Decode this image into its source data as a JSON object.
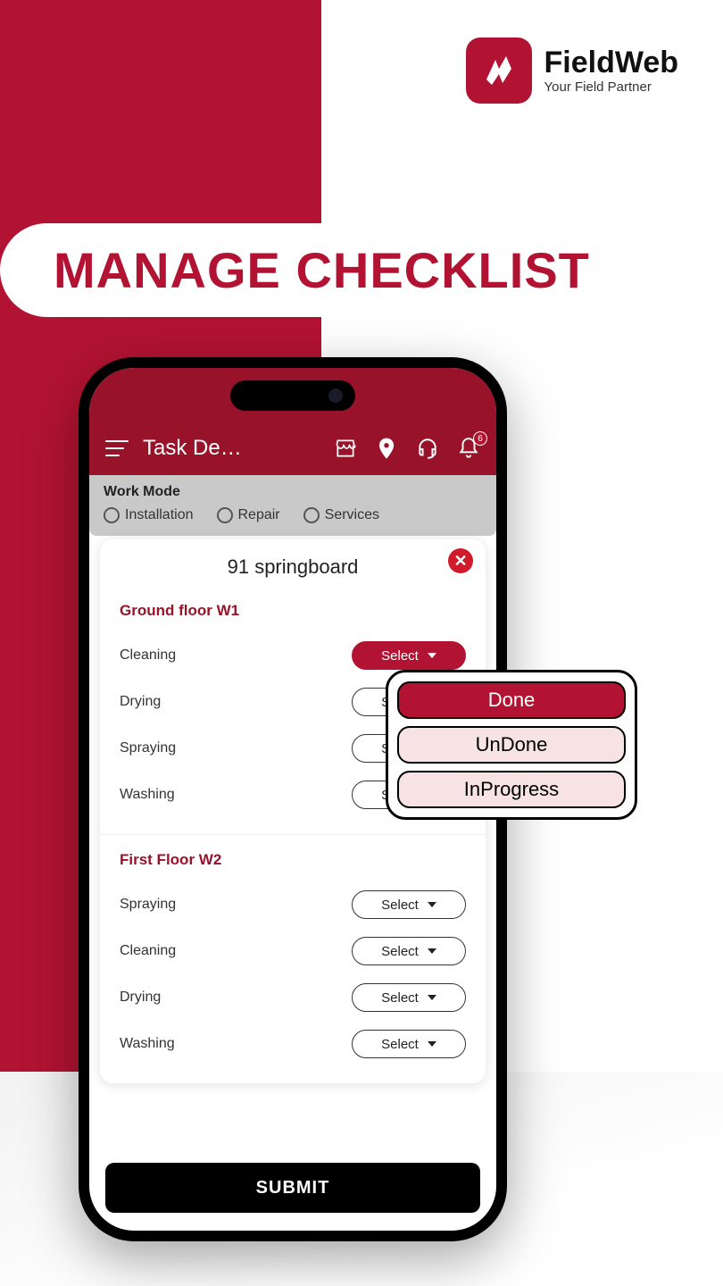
{
  "brand": {
    "name": "FieldWeb",
    "tagline": "Your Field Partner"
  },
  "headline": "MANAGE CHECKLIST",
  "appbar": {
    "title": "Task De…",
    "notification_count": "6"
  },
  "workmode": {
    "label": "Work Mode",
    "options": [
      "Installation",
      "Repair",
      "Services"
    ]
  },
  "modal": {
    "title": "91 springboard",
    "sections": [
      {
        "title": "Ground floor W1",
        "rows": [
          {
            "label": "Cleaning",
            "value": "Select",
            "active": true
          },
          {
            "label": "Drying",
            "value": "Select",
            "active": false
          },
          {
            "label": "Spraying",
            "value": "Select",
            "active": false
          },
          {
            "label": "Washing",
            "value": "Select",
            "active": false
          }
        ]
      },
      {
        "title": "First Floor W2",
        "rows": [
          {
            "label": "Spraying",
            "value": "Select",
            "active": false
          },
          {
            "label": "Cleaning",
            "value": "Select",
            "active": false
          },
          {
            "label": "Drying",
            "value": "Select",
            "active": false
          },
          {
            "label": "Washing",
            "value": "Select",
            "active": false
          }
        ]
      }
    ],
    "submit": "SUBMIT"
  },
  "popover": {
    "options": [
      "Done",
      "UnDone",
      "InProgress"
    ],
    "selected_index": 0
  }
}
